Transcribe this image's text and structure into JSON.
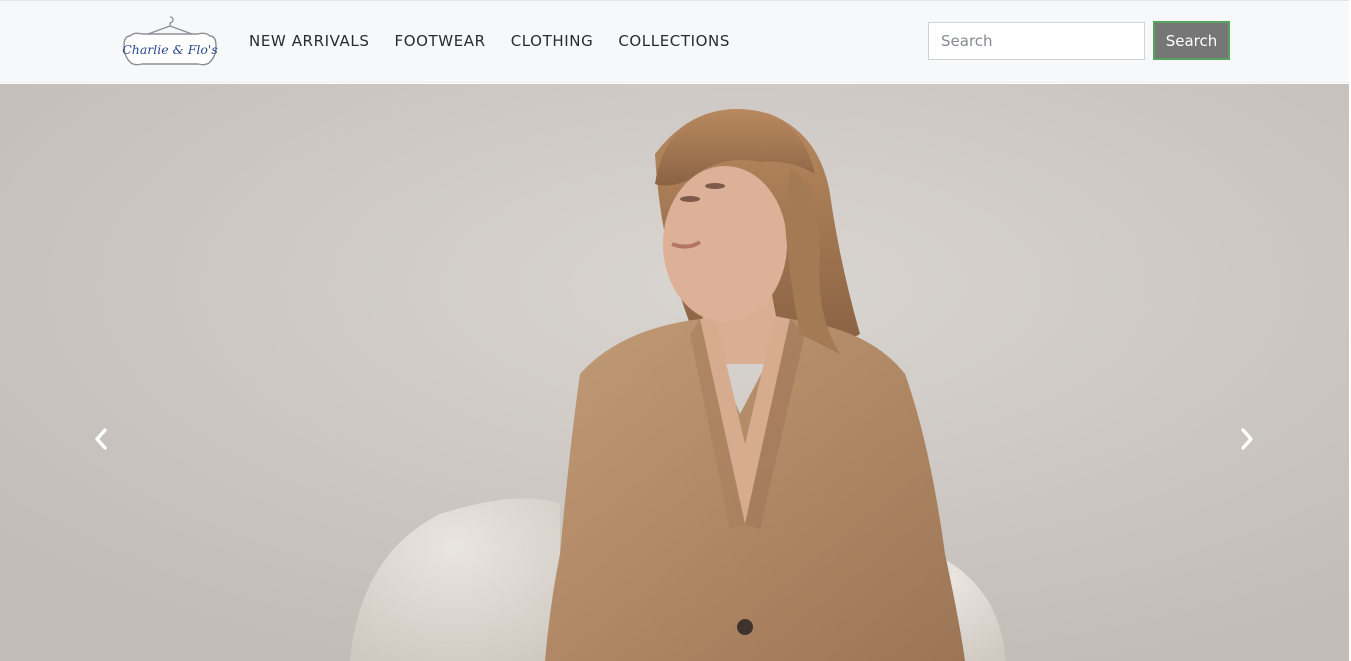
{
  "brand": {
    "logo_text": "Charlie & Flo's",
    "logo_icon": "clothes-hanger-icon",
    "logo_color": "#2a4a8a"
  },
  "nav": {
    "items": [
      {
        "label": "NEW ARRIVALS"
      },
      {
        "label": "FOOTWEAR"
      },
      {
        "label": "CLOTHING"
      },
      {
        "label": "COLLECTIONS"
      }
    ]
  },
  "search": {
    "placeholder": "Search",
    "value": "",
    "button_label": "Search"
  },
  "carousel": {
    "prev_icon": "chevron-left-icon",
    "next_icon": "chevron-right-icon"
  },
  "colors": {
    "navbar_bg": "#f7f8f9",
    "button_bg": "#767676",
    "button_border": "#56a35b",
    "jacket": "#b58e6b"
  }
}
